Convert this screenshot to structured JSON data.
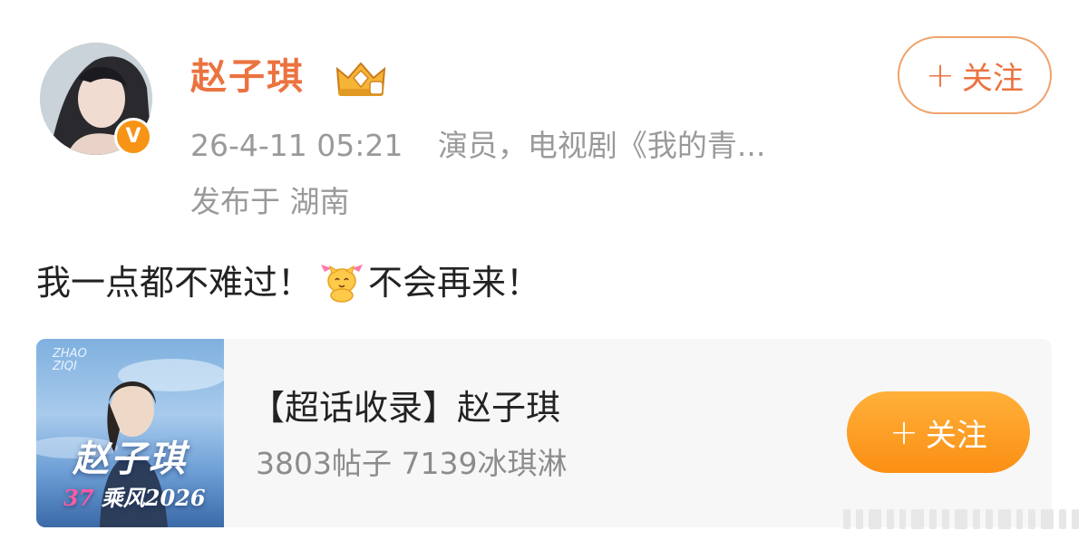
{
  "author": {
    "name": "赵子琪",
    "verified_badge": "V",
    "crown_icon": "crown-icon",
    "accent_color": "#eb7340"
  },
  "follow_button": {
    "plus": "+",
    "label": "关注"
  },
  "meta": {
    "time": "26-4-11 05:21",
    "description": "演员，电视剧《我的青...",
    "location": "发布于 湖南"
  },
  "post": {
    "text_before": "我一点都不难过！",
    "emoji_icon": "cute-cat-emoji",
    "text_after": "不会再来！"
  },
  "card": {
    "cover_top_text": "ZHAO ZIQI",
    "cover_name": "赵子琪",
    "cover_event_mark": "37",
    "cover_event": "乘风2026",
    "title": "【超话收录】赵子琪",
    "stats": "3803帖子 7139冰琪淋",
    "follow_plus": "+",
    "follow_label": "关注",
    "button_color": "#fb8f14"
  }
}
